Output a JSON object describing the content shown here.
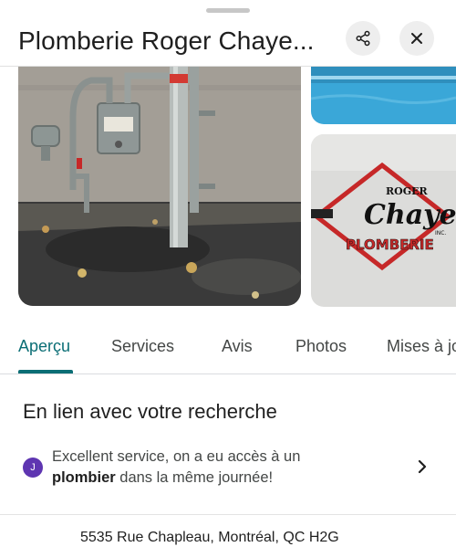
{
  "header": {
    "title": "Plomberie Roger Chaye...",
    "share_icon": "share-icon",
    "close_icon": "close-icon"
  },
  "photos": {
    "logo": {
      "brand_top": "ROGER",
      "brand_mid": "Chayer",
      "brand_small": "INC.",
      "brand_bottom": "PLOMBERIE"
    }
  },
  "tabs": [
    {
      "label": "Aperçu",
      "active": true
    },
    {
      "label": "Services",
      "active": false
    },
    {
      "label": "Avis",
      "active": false
    },
    {
      "label": "Photos",
      "active": false
    },
    {
      "label": "Mises à jour",
      "active": false
    }
  ],
  "related": {
    "heading": "En lien avec votre recherche",
    "review": {
      "avatar_letter": "J",
      "text_before": "Excellent service, on a eu accès à un ",
      "text_bold": "plombier",
      "text_after": " dans la même journée!"
    }
  },
  "address": "5535 Rue Chapleau, Montréal, QC H2G",
  "colors": {
    "accent": "#0b6e75",
    "avatar": "#5e35b1",
    "logo_red": "#c62828"
  }
}
